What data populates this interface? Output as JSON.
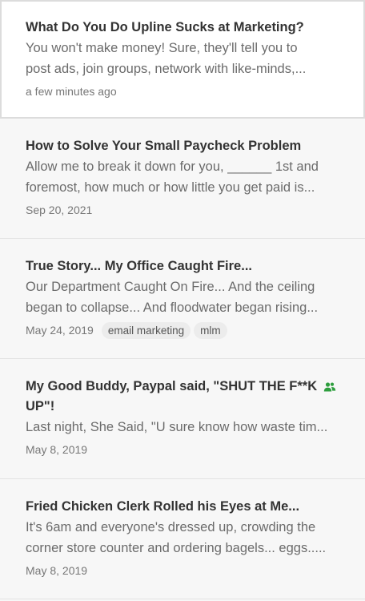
{
  "notes": [
    {
      "title": "What Do You Do Upline Sucks at Marketing?",
      "snippet_line1": "You won't make money! Sure, they'll tell you to",
      "snippet_line2": "post ads, join groups, network with like-minds,...",
      "date": "a few minutes ago"
    },
    {
      "title": "How to Solve Your Small Paycheck Problem",
      "snippet_line1": "Allow me to break it down for you, ______ 1st and",
      "snippet_line2": "foremost, how much or how little you get paid is...",
      "date": "Sep 20, 2021"
    },
    {
      "title": "True Story... My Office Caught Fire...",
      "snippet_line1": "Our Department Caught On Fire... And the ceiling",
      "snippet_line2": "began to collapse... And floodwater began rising...",
      "date": "May 24, 2019",
      "tags": [
        "email marketing",
        "mlm"
      ]
    },
    {
      "title_line1": "My Good Buddy, Paypal said, \"SHUT THE F**K",
      "title_line2": "UP\"!",
      "snippet": "Last night, She Said, \"U sure know how waste tim...",
      "date": "May 8, 2019",
      "icon": "shared-users-icon",
      "icon_color": "#2e9e3e"
    },
    {
      "title": "Fried Chicken Clerk Rolled his Eyes at Me...",
      "snippet_line1": "It's 6am and everyone's dressed up, crowding the",
      "snippet_line2": "corner store counter and ordering bagels... eggs.....",
      "date": "May 8, 2019"
    }
  ]
}
